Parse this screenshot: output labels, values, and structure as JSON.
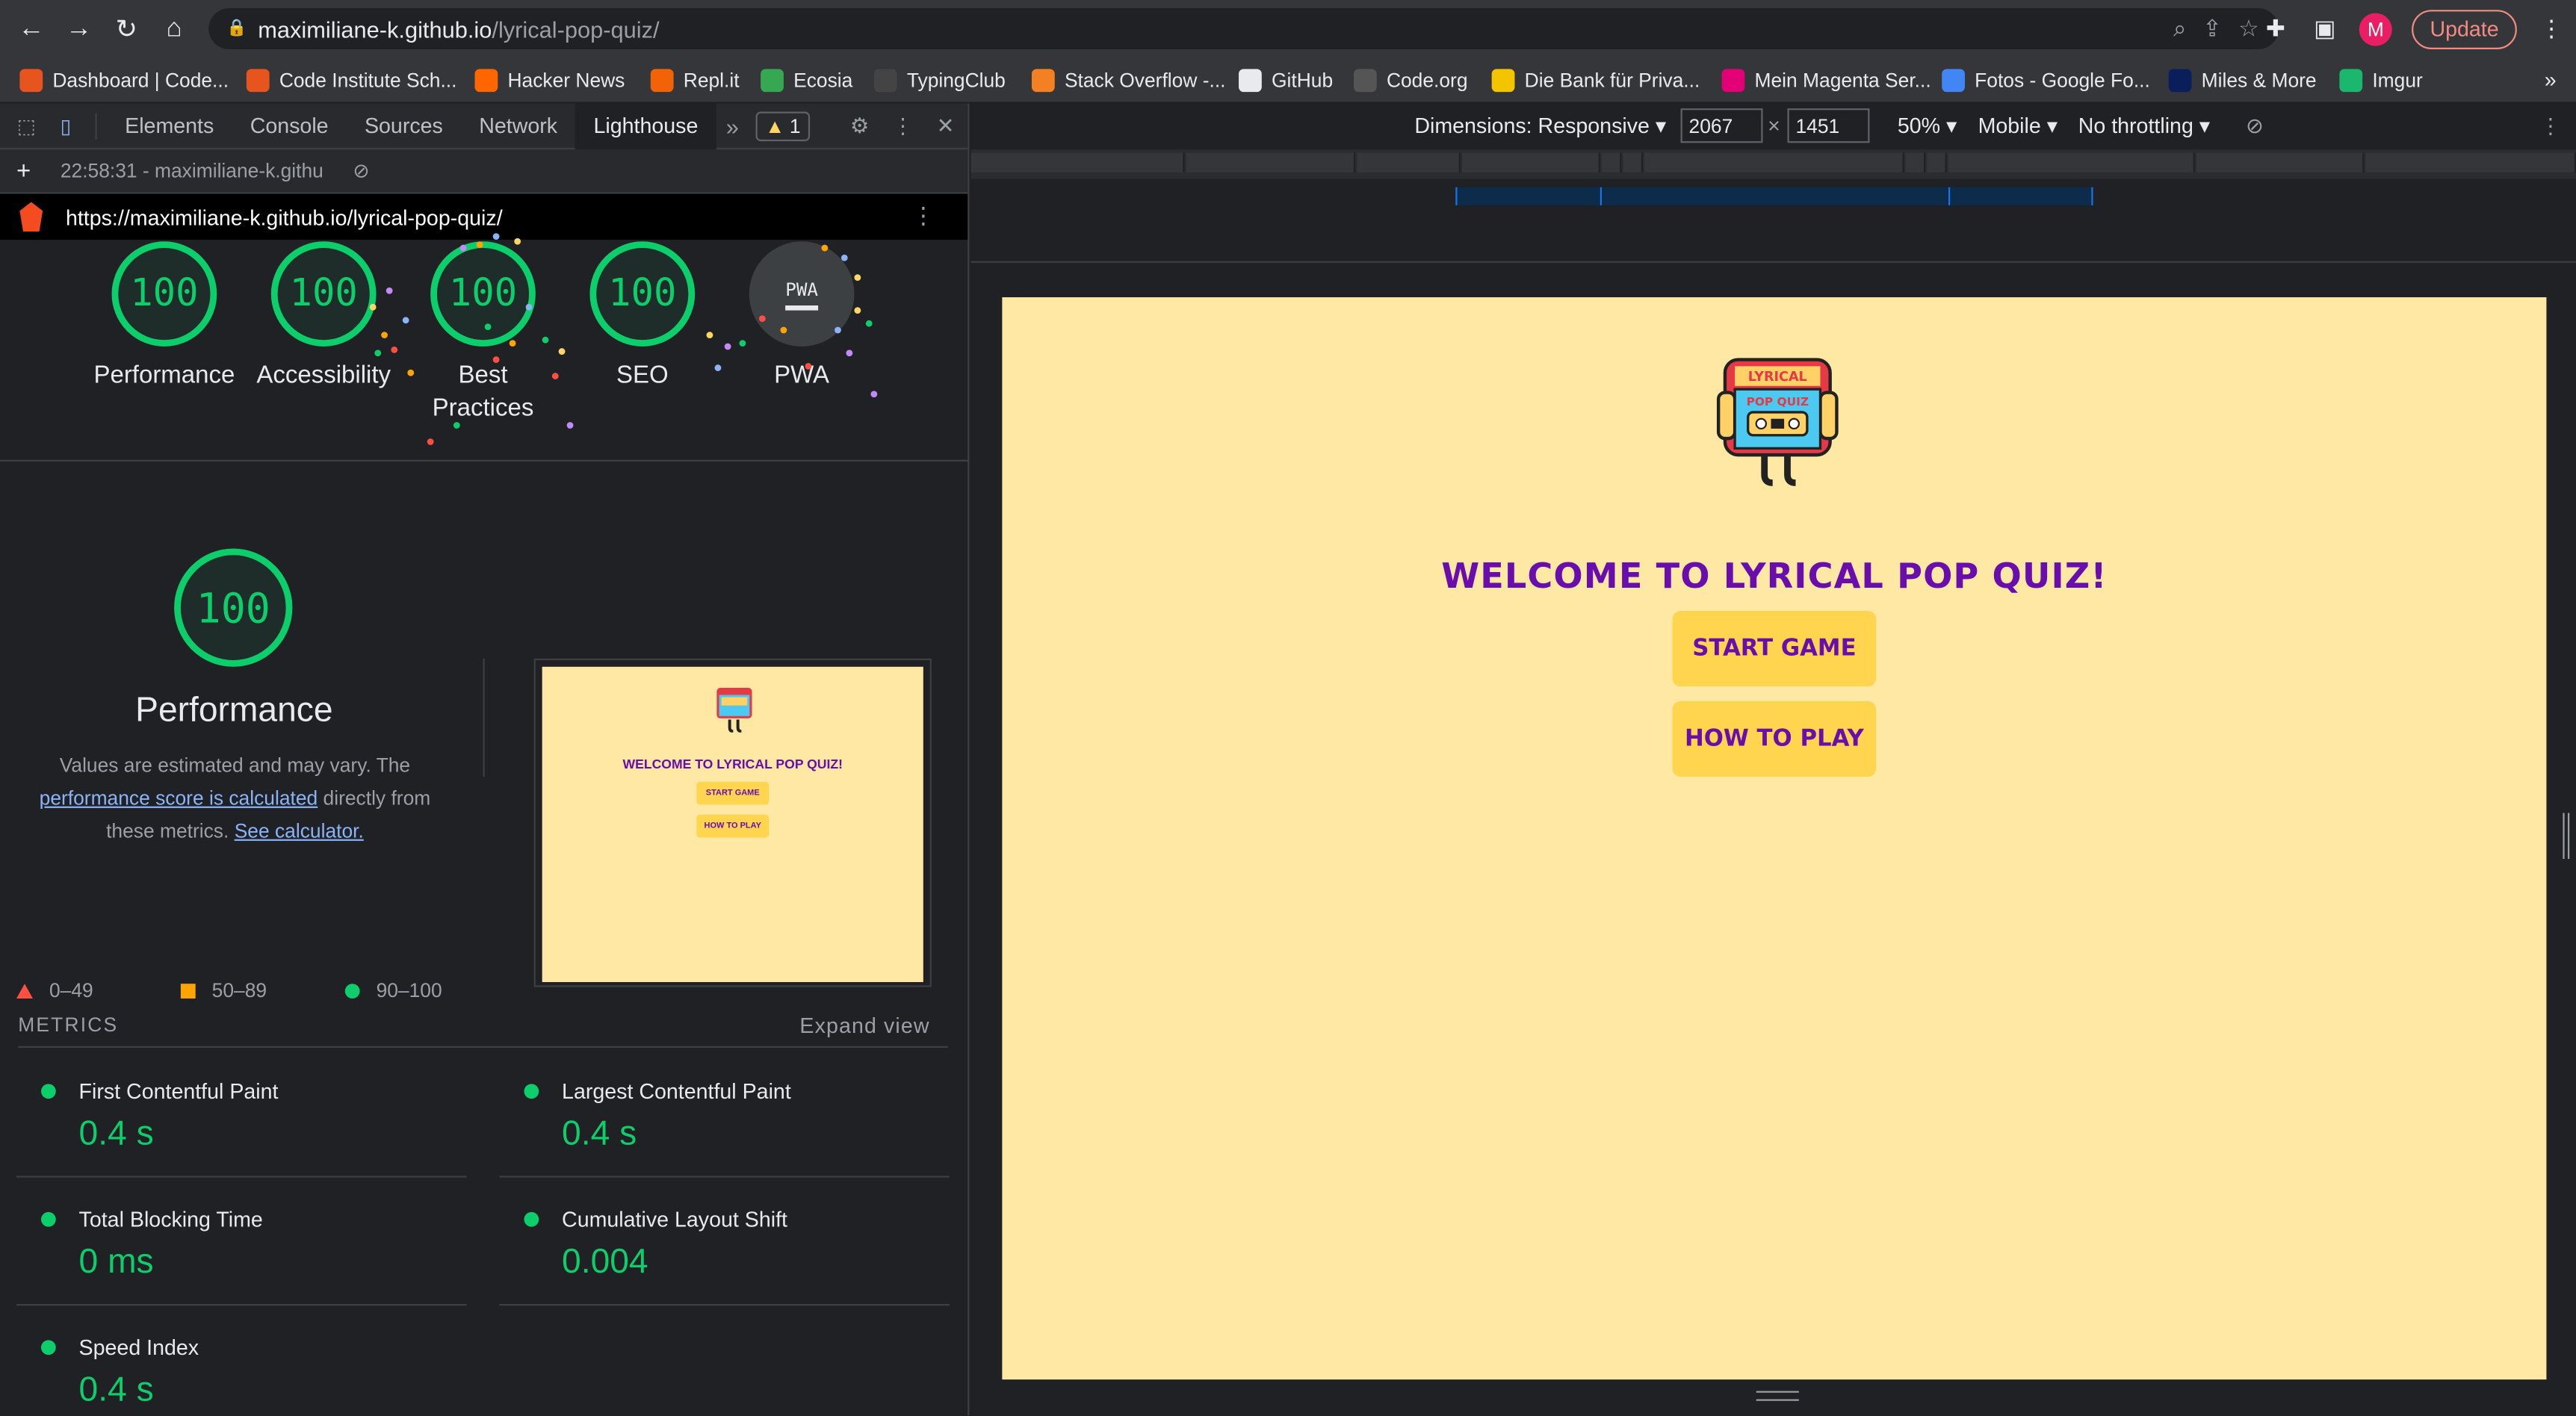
{
  "browser": {
    "url_host": "maximiliane-k.github.io",
    "url_path": "/lyrical-pop-quiz/",
    "update_label": "Update",
    "avatar_letter": "M"
  },
  "bookmarks": [
    {
      "label": "Dashboard | Code...",
      "icon": "code-institute-icon",
      "color": "#e8541d"
    },
    {
      "label": "Code Institute Sch...",
      "icon": "code-institute-icon",
      "color": "#e8541d"
    },
    {
      "label": "Hacker News",
      "icon": "hacker-news-icon",
      "color": "#ff6600"
    },
    {
      "label": "Repl.it",
      "icon": "replit-icon",
      "color": "#f26207"
    },
    {
      "label": "Ecosia",
      "icon": "ecosia-icon",
      "color": "#36a852"
    },
    {
      "label": "TypingClub",
      "icon": "typingclub-icon",
      "color": "#444"
    },
    {
      "label": "Stack Overflow -...",
      "icon": "stackoverflow-icon",
      "color": "#f48024"
    },
    {
      "label": "GitHub",
      "icon": "github-icon",
      "color": "#e8eaed"
    },
    {
      "label": "Code.org",
      "icon": "code-org-icon",
      "color": "#555"
    },
    {
      "label": "Die Bank für Priva...",
      "icon": "bank-icon",
      "color": "#f5c400"
    },
    {
      "label": "Mein Magenta Ser...",
      "icon": "telekom-icon",
      "color": "#e20074"
    },
    {
      "label": "Fotos - Google Fo...",
      "icon": "google-photos-icon",
      "color": "#4285f4"
    },
    {
      "label": "Miles & More",
      "icon": "miles-more-icon",
      "color": "#0a1e5c"
    },
    {
      "label": "Imgur",
      "icon": "imgur-icon",
      "color": "#1bb76e"
    }
  ],
  "devtools": {
    "tabs": [
      "Elements",
      "Console",
      "Sources",
      "Network",
      "Lighthouse"
    ],
    "active_tab": "Lighthouse",
    "warning_count": "1",
    "report_label": "22:58:31 - maximiliane-k.githu",
    "report_url": "https://maximiliane-k.github.io/lyrical-pop-quiz/"
  },
  "scores": [
    {
      "label": "Performance",
      "value": "100"
    },
    {
      "label": "Accessibility",
      "value": "100"
    },
    {
      "label": "Best Practices",
      "value": "100"
    },
    {
      "label": "SEO",
      "value": "100"
    },
    {
      "label": "PWA",
      "value": "PWA"
    }
  ],
  "performance": {
    "score": "100",
    "title": "Performance",
    "desc_1": "Values are estimated and may vary. The",
    "desc_link_1": "performance score is calculated",
    "desc_2": "directly from these metrics.",
    "desc_link_2": "See calculator.",
    "legend": [
      "0–49",
      "50–89",
      "90–100"
    ],
    "thumb_title": "WELCOME TO LYRICAL POP QUIZ!",
    "thumb_btn_1": "START GAME",
    "thumb_btn_2": "HOW TO PLAY"
  },
  "metrics": {
    "header": "METRICS",
    "expand_label": "Expand view",
    "items": [
      {
        "name": "First Contentful Paint",
        "value": "0.4 s"
      },
      {
        "name": "Largest Contentful Paint",
        "value": "0.4 s"
      },
      {
        "name": "Total Blocking Time",
        "value": "0 ms"
      },
      {
        "name": "Cumulative Layout Shift",
        "value": "0.004"
      },
      {
        "name": "Speed Index",
        "value": "0.4 s"
      }
    ]
  },
  "device_toolbar": {
    "dimensions_label": "Dimensions: Responsive",
    "width": "2067",
    "height": "1451",
    "zoom": "50%",
    "device": "Mobile",
    "throttling": "No throttling"
  },
  "page": {
    "logo_line1": "LYRICAL",
    "logo_line2": "POP QUIZ",
    "title": "WELCOME TO LYRICAL POP QUIZ!",
    "start_label": "START GAME",
    "how_label": "HOW TO PLAY"
  },
  "colors": {
    "score_green": "#0cce6b",
    "page_bg": "#ffe8a3",
    "button_bg": "#ffd54f",
    "title_purple": "#6a0dad"
  }
}
